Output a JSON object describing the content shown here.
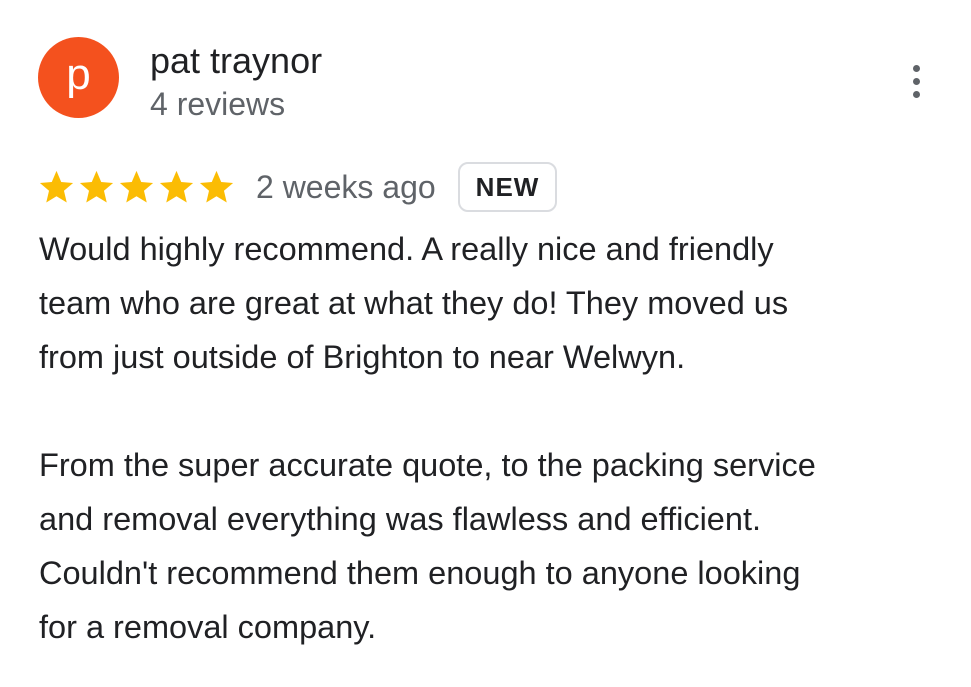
{
  "reviewer": {
    "initial": "p",
    "name": "pat traynor",
    "review_count": "4 reviews",
    "avatar_color": "#f4511e"
  },
  "menu": {
    "icon": "more-vert-icon"
  },
  "rating": {
    "stars": 5,
    "max_stars": 5,
    "star_color": "#fbbc04",
    "date": "2 weeks ago",
    "badge": "NEW"
  },
  "review": {
    "paragraph1": [
      "Would highly recommend. A really nice and friendly",
      "team who are great at what they do! They moved us",
      "from just outside of Brighton to near Welwyn."
    ],
    "paragraph2": [
      "From the super accurate quote, to the packing service",
      "and removal everything was flawless and efficient.",
      "Couldn't recommend them enough to anyone looking",
      "for a removal company."
    ]
  }
}
